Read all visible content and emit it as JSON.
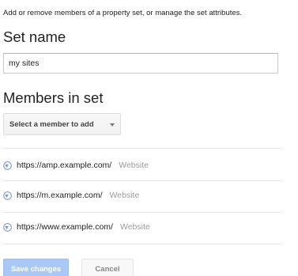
{
  "intro_text": "Add or remove members of a property set, or manage the set attributes.",
  "set_name": {
    "heading": "Set name",
    "value": "my sites"
  },
  "members": {
    "heading": "Members in set",
    "select_label": "Select a member to add",
    "items": [
      {
        "url": "https://amp.example.com/",
        "type": "Website",
        "icon": "globe-icon"
      },
      {
        "url": "https://m.example.com/",
        "type": "Website",
        "icon": "globe-icon"
      },
      {
        "url": "https://www.example.com/",
        "type": "Website",
        "icon": "globe-icon"
      }
    ]
  },
  "actions": {
    "save_label": "Save changes",
    "cancel_label": "Cancel"
  },
  "colors": {
    "save_button_disabled": "#a9c8f6",
    "globe_icon": "#7f9bc4"
  }
}
